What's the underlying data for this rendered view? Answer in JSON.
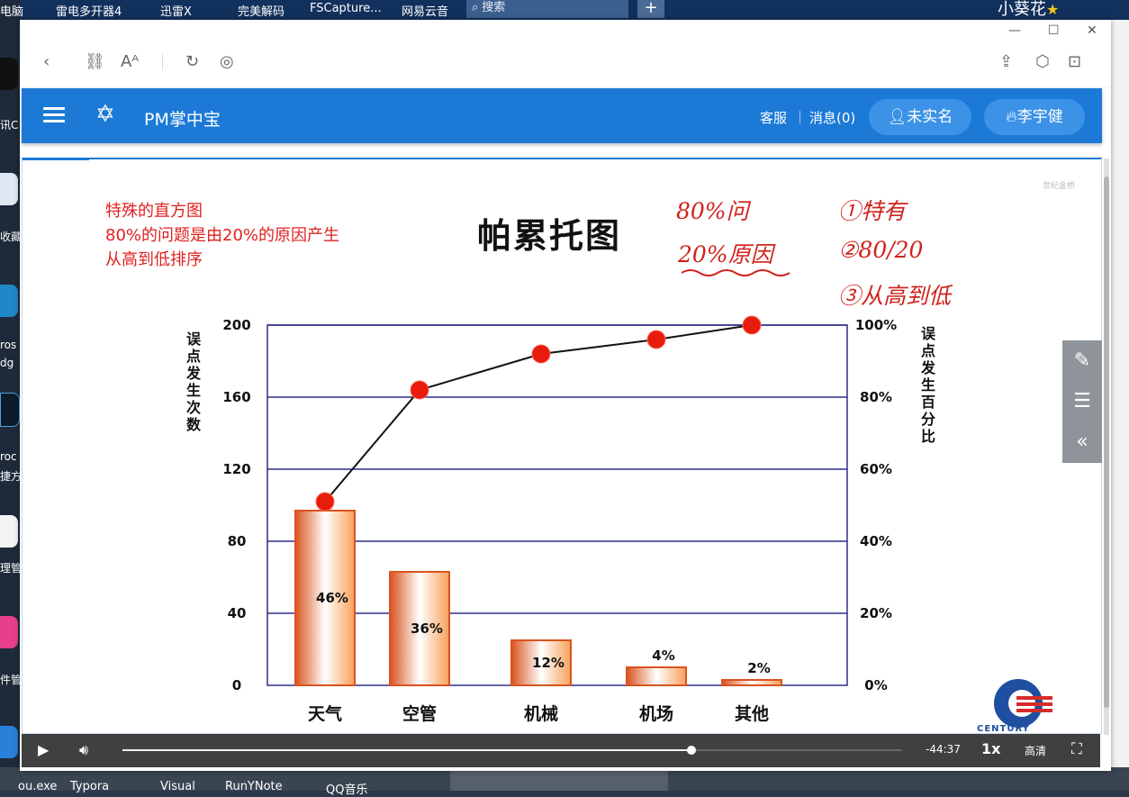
{
  "desktop": {
    "top_labels": [
      "电脑",
      "雷电多开器4",
      "迅雷X",
      "完美解码",
      "FSCapture...",
      "网易云音"
    ],
    "search_placeholder": "搜索",
    "plus": "+",
    "user_name": "小葵花",
    "user_star": "★",
    "left_labels": [
      "讯C",
      "收藏",
      "ros",
      "dg",
      "roc",
      "捷方",
      "理管",
      "件管"
    ],
    "bottom_labels": [
      "ou.exe",
      "Typora",
      "Visual",
      "RunYNote",
      "QQ音乐"
    ]
  },
  "window": {
    "controls": {
      "minimize": "—",
      "maximize": "☐",
      "close": "✕"
    },
    "toolbar_icons": [
      "chevron-left-icon",
      "link-icon",
      "font-size-icon",
      "refresh-icon",
      "compass-icon",
      "share-icon",
      "cube-icon",
      "screenshot-icon"
    ]
  },
  "navbar": {
    "brand": "PM掌中宝",
    "service": "客服",
    "messages": "消息(0)",
    "verify_button": "未实名",
    "user_button": "李宇健",
    "accent": "#1c7ad6"
  },
  "slide": {
    "notes": [
      "特殊的直方图",
      "80%的问题是由20%的原因产生",
      "从高到低排序"
    ],
    "title": "帕累托图",
    "handwriting": {
      "left": [
        "80%问",
        "20%原因"
      ],
      "right": [
        "①特有",
        "②80/20",
        "③从高到低"
      ]
    },
    "watermark_small": "世纪金桥",
    "logo_text": "CENTURY"
  },
  "chart_data": {
    "type": "bar",
    "ylabel_left": "误点发生次数",
    "ylabel_right": "误点发生百分比",
    "categories": [
      "天气",
      "空管",
      "机械",
      "机场",
      "其他"
    ],
    "values": [
      97,
      63,
      25,
      10,
      3
    ],
    "bar_labels": [
      "46%",
      "36%",
      "12%",
      "4%",
      "2%"
    ],
    "left_ticks": [
      0,
      40,
      80,
      120,
      160,
      200
    ],
    "right_ticks": [
      "0%",
      "20%",
      "40%",
      "60%",
      "80%",
      "100%"
    ],
    "ylim": [
      0,
      200
    ],
    "cumulative_percent": [
      51,
      82,
      92,
      96,
      100
    ],
    "colors": {
      "bar_edge": "#d9531e",
      "bar_fill": "#f8a05a",
      "line": "#111111",
      "marker": "#e81c0c",
      "grid": "#2b2f8a"
    }
  },
  "player": {
    "time": "-44:37",
    "speed": "1x",
    "quality": "高清",
    "progress": 0.73
  }
}
